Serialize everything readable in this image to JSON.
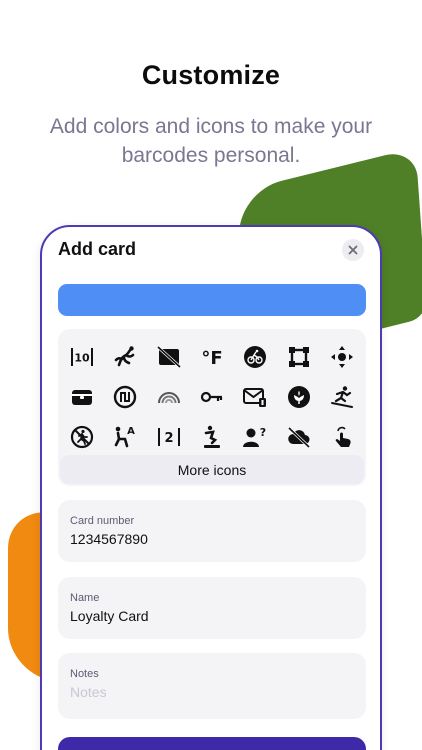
{
  "promo": {
    "headline": "Customize",
    "subline": "Add colors and icons to make your barcodes personal."
  },
  "colors": {
    "accent_border": "#4b3bb4",
    "selected_color": "#4f8ef5",
    "primary_button": "#3e2aa8",
    "deco_green": "#4f7f26",
    "deco_orange": "#f08a10"
  },
  "sheet": {
    "title": "Add card",
    "close_icon": "xmark-icon",
    "icons": [
      "number-10-icon",
      "gecko-icon",
      "barcode-slash-icon",
      "fahrenheit-icon",
      "bicycle-circle-icon",
      "crop-frame-icon",
      "move-arrows-icon",
      "wallet-card-icon",
      "shekel-circle-icon",
      "rainbow-icon",
      "key-icon",
      "envelope-badge-icon",
      "flower-circle-icon",
      "snowboarder-icon",
      "runner-slash-icon",
      "seated-person-letter-icon",
      "number-2-icon",
      "skier-icon",
      "person-question-icon",
      "cloud-slash-icon",
      "hand-tap-icon"
    ],
    "icon_text": {
      "ten": "10",
      "two": "2",
      "fahrenheit": "°F",
      "letter_a": "A",
      "question": "?"
    },
    "more_icons_label": "More icons",
    "fields": {
      "card_number": {
        "label": "Card number",
        "value": "1234567890"
      },
      "name": {
        "label": "Name",
        "value": "Loyalty Card"
      },
      "notes": {
        "label": "Notes",
        "placeholder": "Notes"
      }
    }
  }
}
